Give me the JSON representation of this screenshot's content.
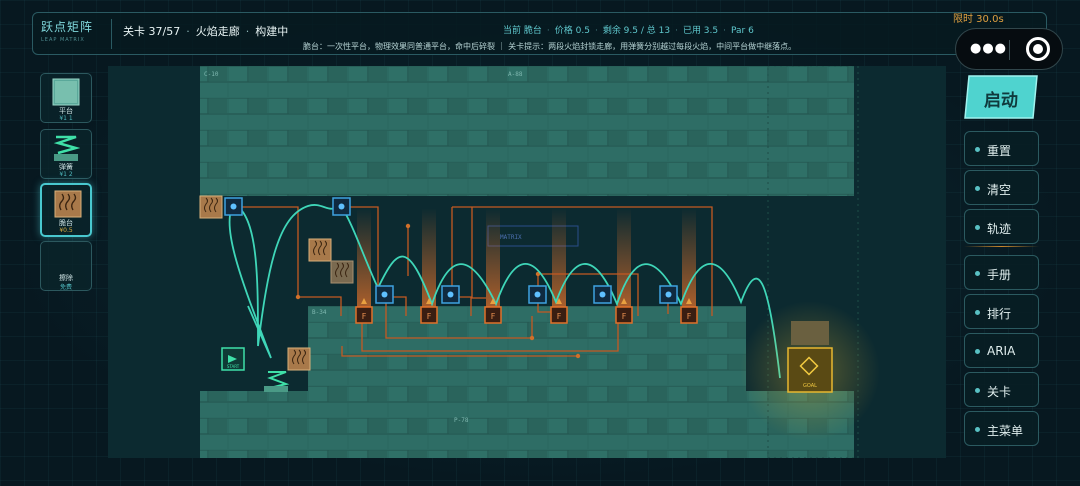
{
  "header": {
    "logo_title": "跃点矩阵",
    "logo_subtitle": "LEAP MATRIX",
    "level": "关卡 37/57",
    "level_name": "火焰走廊",
    "status": "构建中",
    "separator": "·",
    "stats": {
      "current": "当前 脆台",
      "price": "价格 0.5",
      "remaining": "剩余 9.5 / 总 13",
      "used": "已用 3.5",
      "par": "Par 6"
    },
    "description": "脆台：一次性平台，物理效果同普通平台，命中后碎裂 ｜ 关卡提示：两段火焰封锁走廊，用弹簧分别越过每段火焰，中间平台做中继落点。",
    "timer": "限时 30.0s"
  },
  "palette": [
    {
      "name": "平台",
      "price": "¥1 1",
      "icon": "platform-icon",
      "selected": false
    },
    {
      "name": "弹簧",
      "price": "¥1 2",
      "icon": "spring-icon",
      "selected": false
    },
    {
      "name": "脆台",
      "price": "¥0.5",
      "icon": "fragile-platform-icon",
      "selected": true
    },
    {
      "name": "擦除",
      "price": "免费",
      "icon": "eraser-icon",
      "selected": false
    }
  ],
  "board": {
    "sector_labels": [
      "C-10",
      "A-88",
      "B-34",
      "P-78"
    ],
    "chip_labels": [
      "MATRIX"
    ],
    "start_label": "START",
    "goal_label": "GOAL",
    "fire_label": "F"
  },
  "menu": {
    "start": "启动",
    "items": [
      "重置",
      "清空",
      "轨迹",
      "手册",
      "排行",
      "ARIA",
      "关卡",
      "主菜单"
    ]
  },
  "colors": {
    "accent": "#49c8cf",
    "fire": "#e0702a",
    "goal": "#e8b830",
    "trajectory": "#3fd6b8",
    "switch": "#3fa2e0"
  }
}
